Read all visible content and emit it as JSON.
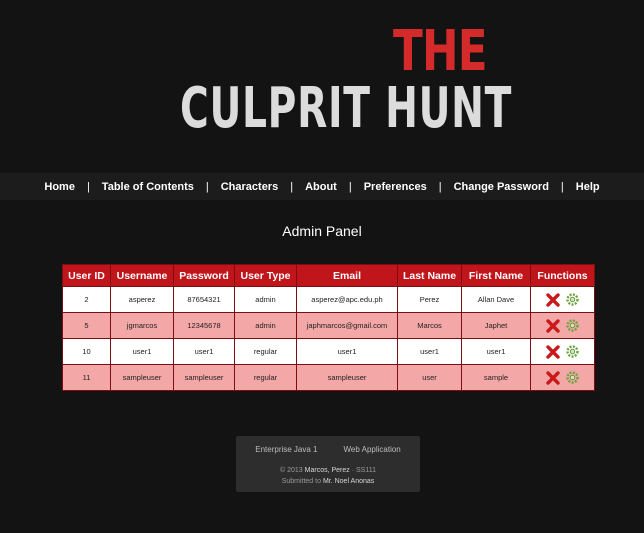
{
  "logo": {
    "the": "THE",
    "main": "CULPRIT HUNT"
  },
  "nav": {
    "items": [
      "Home",
      "Table of Contents",
      "Characters",
      "About",
      "Preferences",
      "Change Password",
      "Help"
    ],
    "separator": "|"
  },
  "panel": {
    "title": "Admin Panel"
  },
  "table": {
    "headers": [
      "User ID",
      "Username",
      "Password",
      "User Type",
      "Email",
      "Last Name",
      "First Name",
      "Functions"
    ],
    "rows": [
      [
        "2",
        "asperez",
        "87654321",
        "admin",
        "asperez@apc.edu.ph",
        "Perez",
        "Allan Dave"
      ],
      [
        "5",
        "jgmarcos",
        "12345678",
        "admin",
        "japhmarcos@gmail.com",
        "Marcos",
        "Japhet"
      ],
      [
        "10",
        "user1",
        "user1",
        "regular",
        "user1",
        "user1",
        "user1"
      ],
      [
        "11",
        "sampleuser",
        "sampleuser",
        "regular",
        "sampleuser",
        "user",
        "sample"
      ]
    ],
    "functions": {
      "delete_icon": "delete-x-icon",
      "edit_icon": "gear-icon"
    }
  },
  "footer": {
    "link1": "Enterprise Java 1",
    "link2": "Web Application",
    "copy_prefix": "© 2013 ",
    "authors": "Marcos, Perez",
    "section": " · SS111",
    "submitted_prefix": "Submitted to ",
    "teacher": "Mr. Noel Anonas"
  },
  "colors": {
    "header_red": "#c0161b",
    "row_pink": "#f3a7a7",
    "logo_red": "#d42a2a",
    "background": "#131313"
  }
}
